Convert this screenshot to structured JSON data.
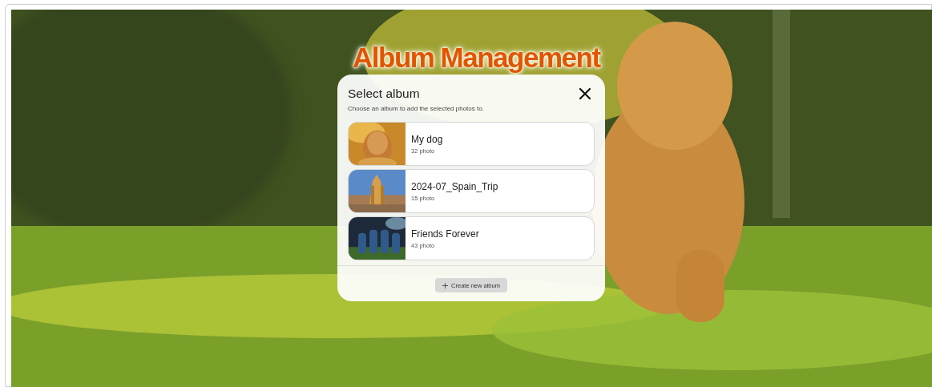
{
  "page_title": "Album Management",
  "dialog": {
    "title": "Select album",
    "subtitle": "Choose an album to add the selected photos to.",
    "albums": [
      {
        "name": "My dog",
        "count": "32 photo"
      },
      {
        "name": "2024-07_Spain_Trip",
        "count": "15 photo"
      },
      {
        "name": "Friends Forever",
        "count": "43 photo"
      }
    ],
    "create_button": "Create new album"
  }
}
